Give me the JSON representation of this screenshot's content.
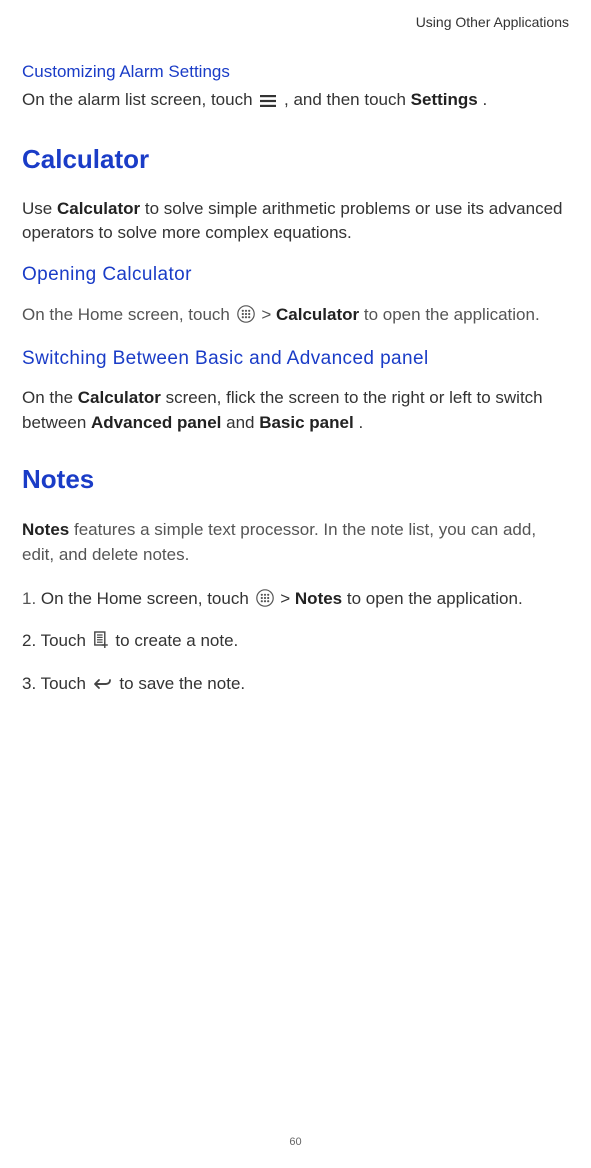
{
  "header": "Using Other Applications",
  "alarm": {
    "heading": "Customizing Alarm Settings",
    "p1a": "On the alarm list screen, touch ",
    "p1b": " , and then touch ",
    "p1c": "Settings",
    "p1d": "."
  },
  "calc": {
    "title": "Calculator",
    "intro_a": "Use ",
    "intro_b": "Calculator",
    "intro_c": " to solve simple arithmetic problems or use its advanced operators to solve more complex equations.",
    "open_heading": "Opening Calculator",
    "open_a": "On the Home screen, touch ",
    "open_b": " > ",
    "open_c": "Calculator",
    "open_d": " to open the application.",
    "switch_heading": "Switching Between Basic and Advanced panel",
    "switch_a": "On the ",
    "switch_b": "Calculator",
    "switch_c": " screen, flick the screen to the right or left to switch between ",
    "switch_d": "Advanced panel",
    "switch_e": " and ",
    "switch_f": "Basic panel",
    "switch_g": "."
  },
  "notes": {
    "title": "Notes",
    "intro_a": "Notes",
    "intro_b": " features a simple text processor. In the note list, you can add, edit, and delete notes.",
    "s1a": "1. ",
    "s1b": "On the Home screen, touch ",
    "s1c": " > ",
    "s1d": "Notes",
    "s1e": " to open the application.",
    "s2a": "2. Touch ",
    "s2b": " to create a note.",
    "s3a": "3. Touch ",
    "s3b": " to save the note."
  },
  "page_number": "60"
}
